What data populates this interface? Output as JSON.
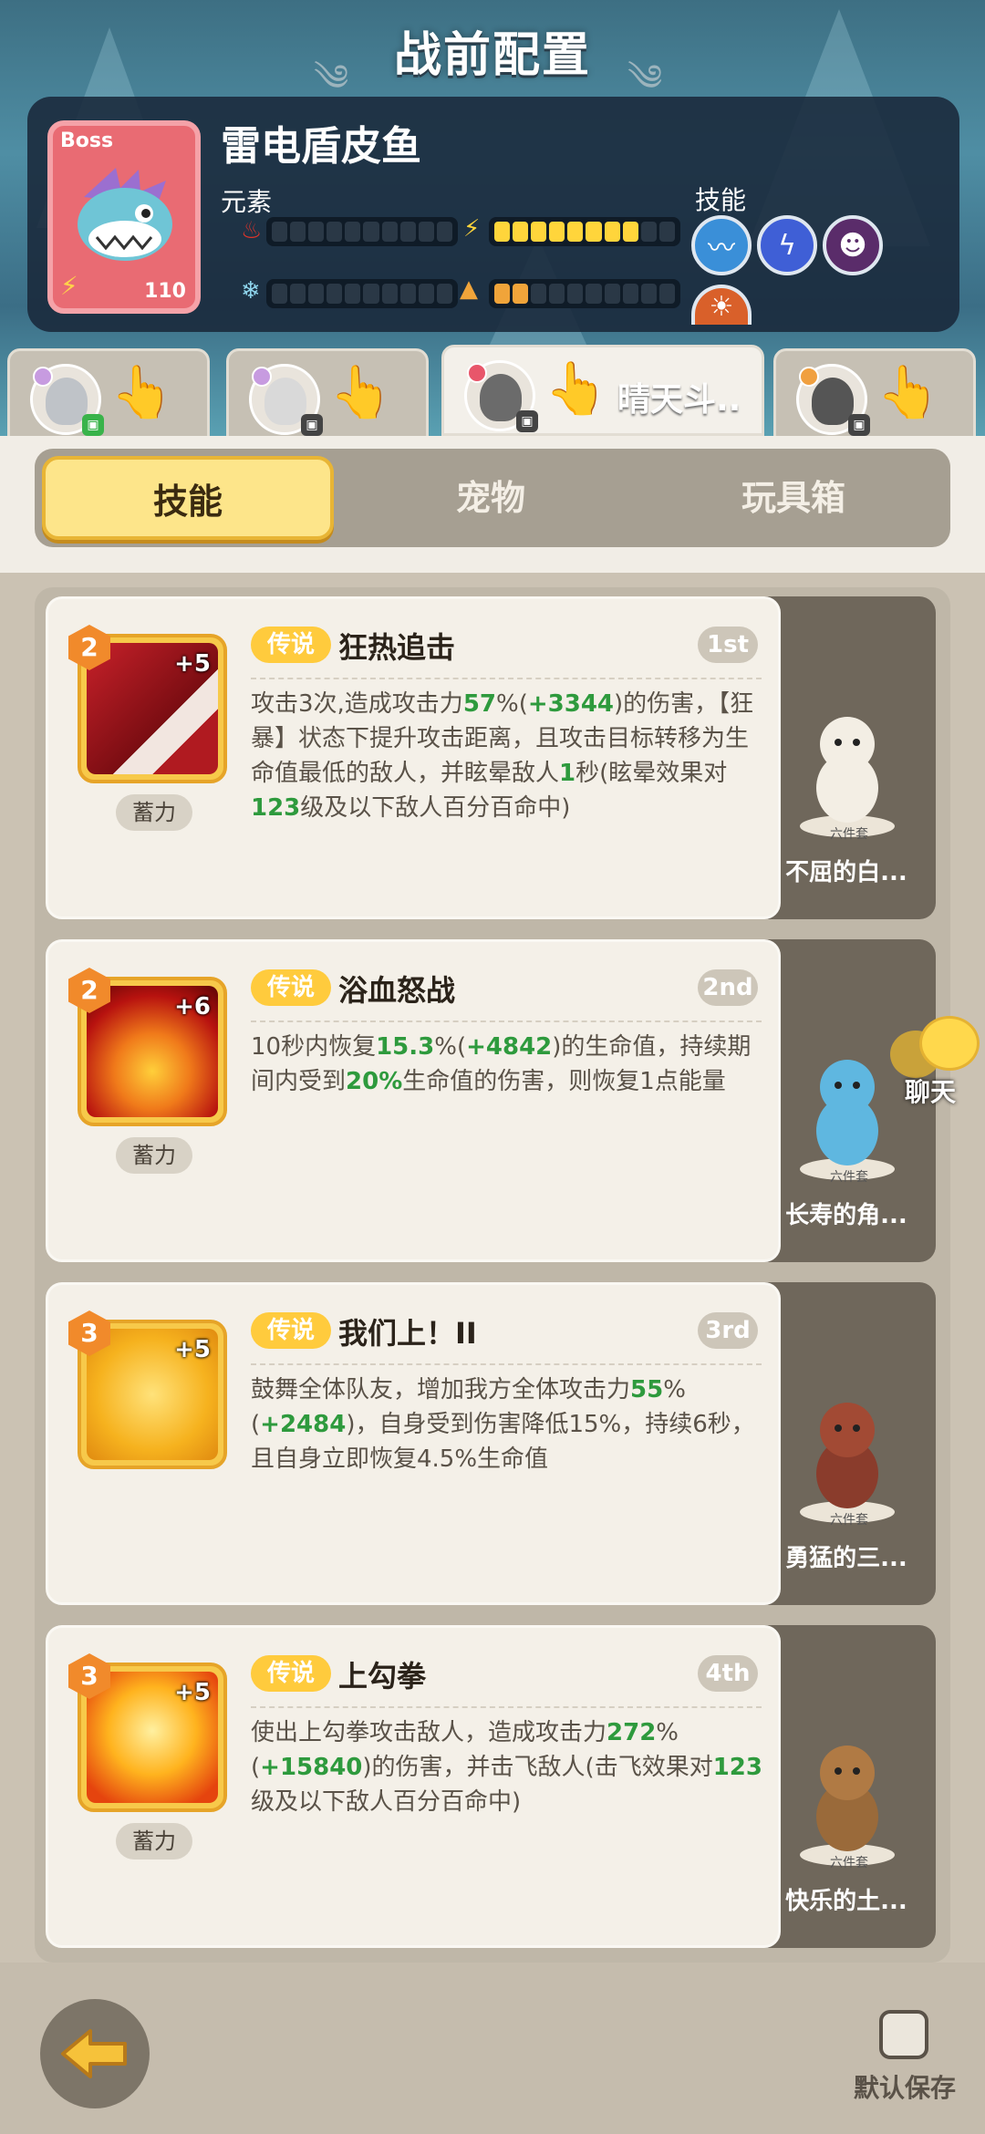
{
  "page": {
    "title": "战前配置"
  },
  "boss": {
    "tag": "Boss",
    "level": "110",
    "name": "雷电盾皮鱼",
    "element_label": "元素",
    "skill_label": "技能",
    "bars": [
      {
        "icon": "fire-icon",
        "filled": 0,
        "total": 10
      },
      {
        "icon": "lightning-icon",
        "filled": 8,
        "total": 10
      },
      {
        "icon": "ice-icon",
        "filled": 0,
        "total": 10
      },
      {
        "icon": "earth-icon",
        "filled": 2,
        "total": 10
      }
    ],
    "skill_icons": [
      "ice-wave-icon",
      "lightning-skill-icon",
      "dark-monster-icon",
      "sun-skill-icon"
    ]
  },
  "characters": [
    {
      "name": "",
      "badge": "green"
    },
    {
      "name": "",
      "badge": "dark"
    },
    {
      "name": "晴天斗..",
      "badge": "dark",
      "active": true
    },
    {
      "name": "",
      "badge": "dark"
    }
  ],
  "tabs": {
    "skills": "技能",
    "pets": "宠物",
    "toybox": "玩具箱"
  },
  "cards": [
    {
      "level": "2",
      "plus": "+5",
      "charge": "蓄力",
      "legend": "传说",
      "title": "狂热追击",
      "rank": "1st",
      "desc_html_parts": [
        "攻击3次,造成攻击力",
        "57",
        "%(",
        "+3344",
        ")的伤害，【狂暴】状态下提升攻击距离，且攻击目标转移为生命值最低的敌人，并眩晕敌人",
        "1",
        "秒(眩晕效果对",
        "123",
        "级及以下敌人百分百命中)"
      ],
      "pet_name": "不屈的白...",
      "pedestal": "六件套",
      "art": "red"
    },
    {
      "level": "2",
      "plus": "+6",
      "charge": "蓄力",
      "legend": "传说",
      "title": "浴血怒战",
      "rank": "2nd",
      "desc_html_parts": [
        "10秒内恢复",
        "15.3",
        "%(",
        "+4842",
        ")的生命值，持续期间内受到",
        "20%",
        "生命值的伤害，则恢复1点能量"
      ],
      "pet_name": "长寿的角...",
      "pedestal": "六件套",
      "art": "blood"
    },
    {
      "level": "3",
      "plus": "+5",
      "charge": "",
      "legend": "传说",
      "title": "我们上！II",
      "rank": "3rd",
      "desc_html_parts": [
        "鼓舞全体队友，增加我方全体攻击力",
        "55",
        "%(",
        "+2484",
        ")，自身受到伤害降低15%，持续6秒，且自身立即恢复4.5%生命值"
      ],
      "pet_name": "勇猛的三...",
      "pedestal": "六件套",
      "art": "yellow"
    },
    {
      "level": "3",
      "plus": "+5",
      "charge": "蓄力",
      "legend": "传说",
      "title": "上勾拳",
      "rank": "4th",
      "desc_html_parts": [
        "使出上勾拳攻击敌人，造成攻击力",
        "272",
        "%(",
        "+15840",
        ")的伤害，并击飞敌人(击飞效果对",
        "123",
        "级及以下敌人百分百命中)"
      ],
      "pet_name": "快乐的土...",
      "pedestal": "六件套",
      "art": "fist"
    }
  ],
  "chat": {
    "label": "聊天"
  },
  "footer": {
    "save_label": "默认保存"
  },
  "colors": {
    "accent_yellow": "#fde58a",
    "highlight_green": "#2e9a3d",
    "boss_red": "#e96b73"
  }
}
